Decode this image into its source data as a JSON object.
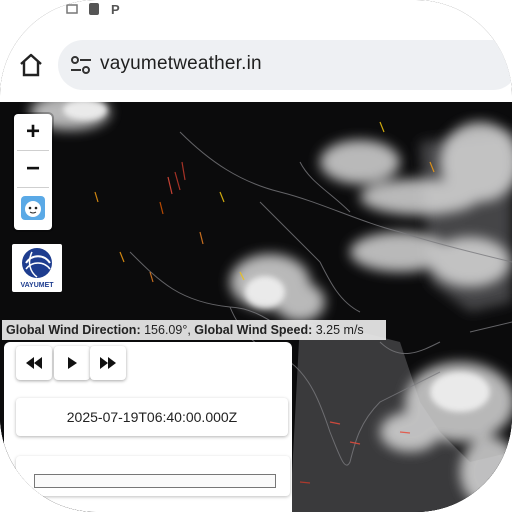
{
  "browser": {
    "url": "vayumetweather.in"
  },
  "map": {
    "zoom_in_label": "+",
    "zoom_out_label": "−",
    "logo_text": "VAYUMET",
    "wind_direction_label": "Global Wind Direction:",
    "wind_direction_value": "156.09°,",
    "wind_speed_label": "Global Wind Speed:",
    "wind_speed_value": "3.25 m/s"
  },
  "playback": {
    "timestamp": "2025-07-19T06:40:00.000Z",
    "controls": [
      "rewind",
      "play",
      "fast-forward"
    ]
  },
  "colors": {
    "accent": "#1e3d8f",
    "address_bar": "#eef0f3",
    "map_bg": "#0b0b0c"
  }
}
